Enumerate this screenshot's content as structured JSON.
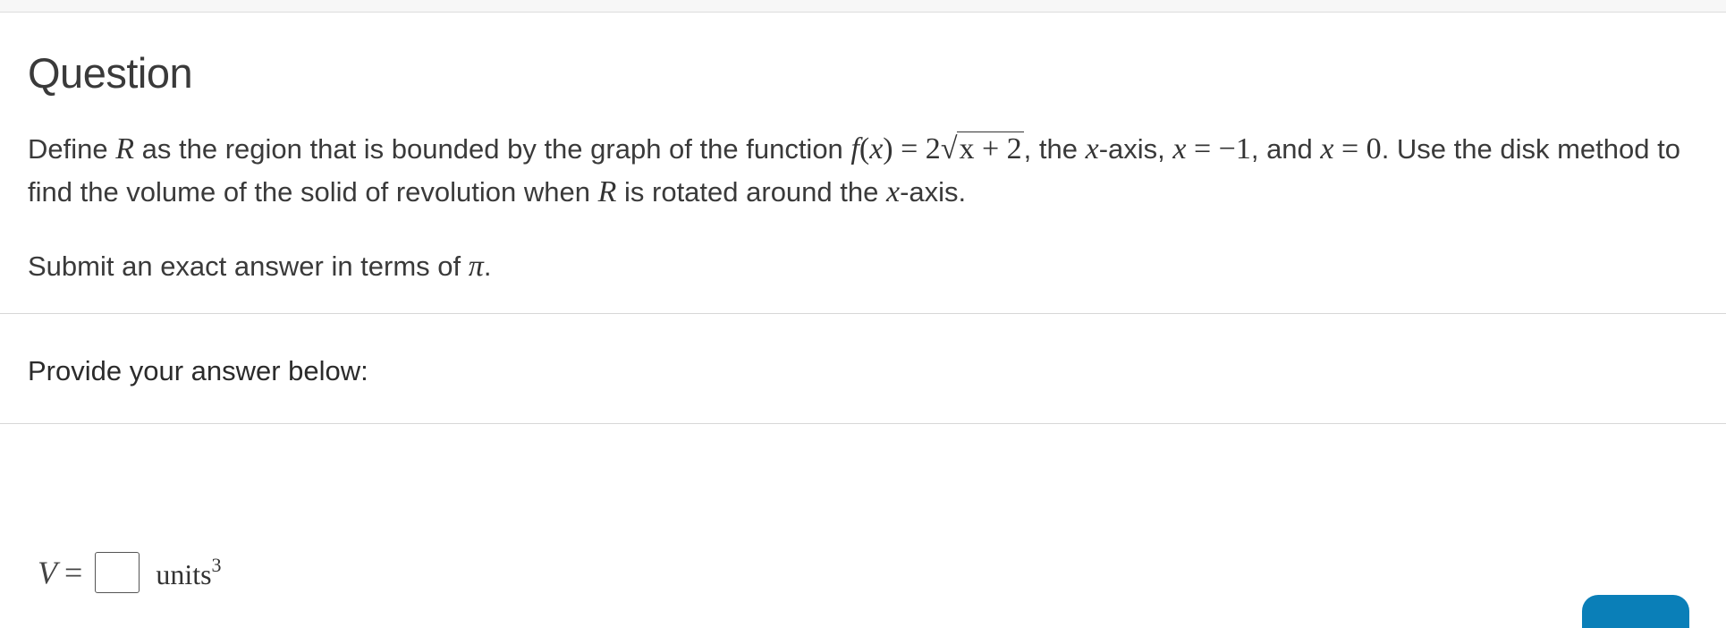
{
  "question": {
    "heading": "Question",
    "prompt_part1": "Define ",
    "prompt_R1": "R",
    "prompt_part2": " as the region that is bounded by the graph of the function ",
    "f_lhs": "f",
    "f_paren_open": "(",
    "f_x": "x",
    "f_paren_close": ")",
    "f_eq": " = 2",
    "f_radicand": "x + 2",
    "prompt_part3": ", the ",
    "x_axis_var1": "x",
    "prompt_part4": "-axis, ",
    "bound1_var": "x",
    "bound1_rest": " = −1",
    "prompt_part5": ", and ",
    "bound2_var": "x",
    "bound2_rest": " = 0",
    "prompt_part6": ". Use the disk method to find the volume of the solid of revolution when ",
    "prompt_R2": "R",
    "prompt_part7": " is rotated around the ",
    "x_axis_var2": "x",
    "prompt_part8": "-axis.",
    "submit_note_text": "Submit an exact answer in terms of ",
    "submit_note_pi": "π",
    "submit_note_end": "."
  },
  "answer": {
    "label": "Provide your answer below:",
    "variable": "V",
    "equals": "=",
    "box_value": "",
    "units": "units",
    "units_exponent": "3"
  },
  "colors": {
    "submit_button": "#0a7fb8",
    "divider": "#d7d7d7"
  }
}
